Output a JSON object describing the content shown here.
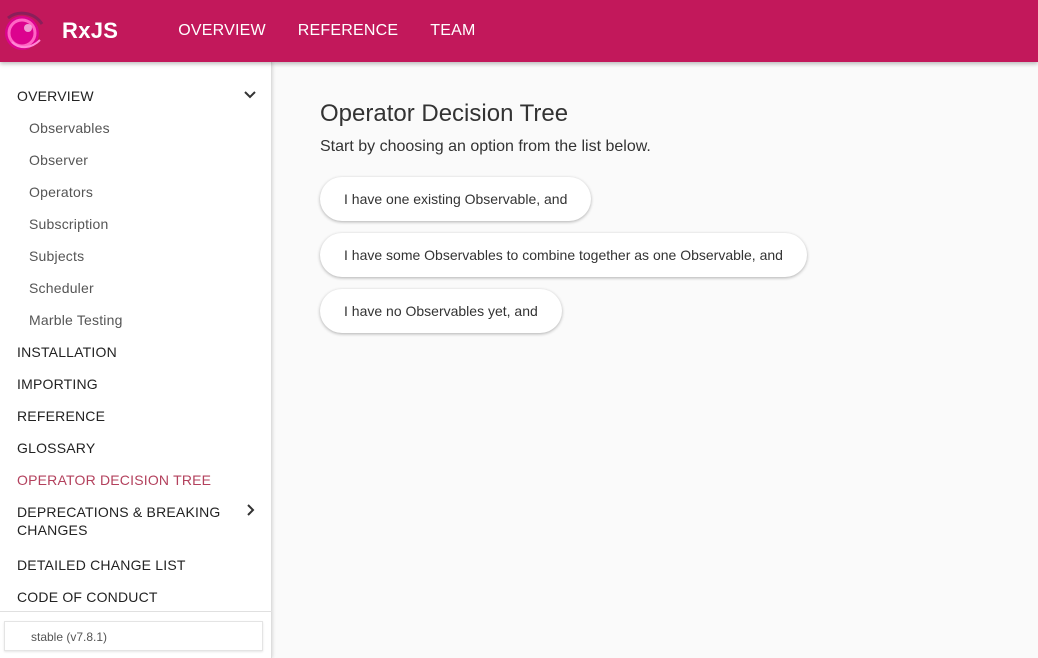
{
  "header": {
    "brand": "RxJS",
    "logo_icon": "rxjs-logo-icon",
    "nav": [
      "OVERVIEW",
      "REFERENCE",
      "TEAM"
    ],
    "background_color": "#c2185b"
  },
  "sidebar": {
    "overview": {
      "label": "OVERVIEW",
      "icon": "chevron-down-icon",
      "expanded": true
    },
    "overview_children": [
      "Observables",
      "Observer",
      "Operators",
      "Subscription",
      "Subjects",
      "Scheduler",
      "Marble Testing"
    ],
    "items": [
      "INSTALLATION",
      "IMPORTING",
      "REFERENCE",
      "GLOSSARY",
      "OPERATOR DECISION TREE"
    ],
    "deprecations": {
      "line1": "DEPRECATIONS & BREAKING",
      "line2": "CHANGES",
      "icon": "chevron-right-icon"
    },
    "items_after": [
      "DETAILED CHANGE LIST",
      "CODE OF CONDUCT"
    ],
    "active_item": "OPERATOR DECISION TREE",
    "active_color": "#b3415d",
    "version": "stable (v7.8.1)"
  },
  "main": {
    "title": "Operator Decision Tree",
    "intro": "Start by choosing an option from the list below.",
    "options": [
      "I have one existing Observable, and",
      "I have some Observables to combine together as one Observable, and",
      "I have no Observables yet, and"
    ]
  }
}
